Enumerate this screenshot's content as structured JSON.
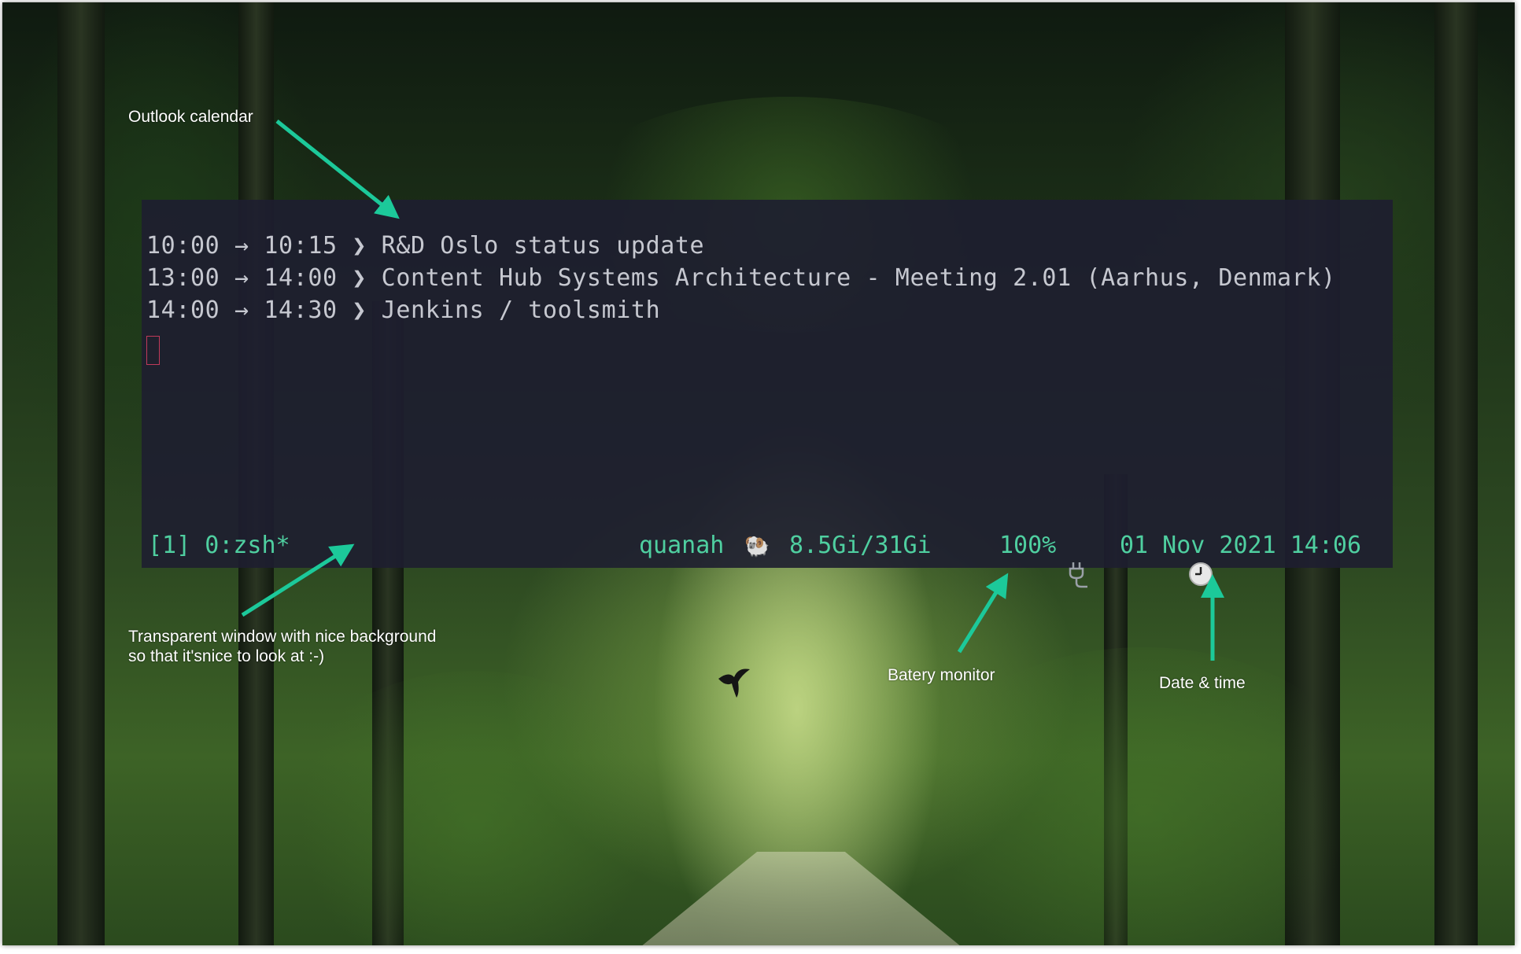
{
  "calendar": {
    "events": [
      {
        "start": "10:00",
        "arrow": "→",
        "end": "10:15",
        "sep": "❯",
        "title": "R&D Oslo status update"
      },
      {
        "start": "13:00",
        "arrow": "→",
        "end": "14:00",
        "sep": "❯",
        "title": "Content Hub Systems Architecture - Meeting 2.01 (Aarhus, Denmark)"
      },
      {
        "start": "14:00",
        "arrow": "→",
        "end": "14:30",
        "sep": "❯",
        "title": "Jenkins / toolsmith"
      }
    ]
  },
  "statusbar": {
    "session": "[1] 0:zsh*",
    "host": "quanah",
    "memory_icon": "ram-icon",
    "memory": "8.5Gi/31Gi",
    "power_icon": "plug-icon",
    "battery": "100%",
    "clock_icon": "clock-icon",
    "datetime": "01 Nov 2021 14:06"
  },
  "annotations": {
    "calendar": "Outlook calendar",
    "window_line1": "Transparent window with nice background",
    "window_line2": "so that it'snice to look at :-)",
    "battery": "Batery monitor",
    "datetime": "Date & time"
  },
  "colors": {
    "terminal_bg": "#1e1e30",
    "terminal_text": "#c6c8d0",
    "status_text": "#4fcfa0",
    "annotation_arrow": "#1cc99a",
    "cursor": "#c03a5a"
  }
}
